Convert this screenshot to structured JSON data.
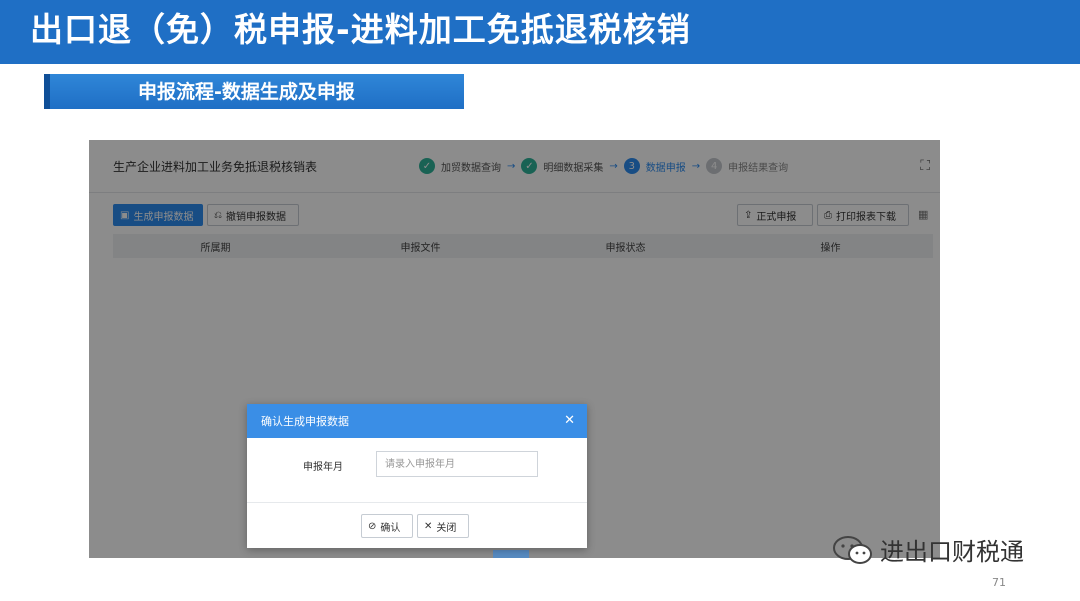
{
  "slide": {
    "title": "出口退（免）税申报-进料加工免抵退税核销",
    "subtitle": "申报流程-数据生成及申报",
    "page_number": "71",
    "watermark": "进出口财税通"
  },
  "app": {
    "title": "生产企业进料加工业务免抵退税核销表",
    "steps": [
      {
        "label": "加贸数据查询",
        "state": "done"
      },
      {
        "label": "明细数据采集",
        "state": "done"
      },
      {
        "label": "数据申报",
        "state": "active",
        "number": "3"
      },
      {
        "label": "申报结果查询",
        "state": "pending",
        "number": "4"
      }
    ],
    "toolbar": {
      "generate_label": "生成申报数据",
      "cancel_label": "撤销申报数据",
      "formal_label": "正式申报",
      "print_label": "打印报表下载"
    },
    "table": {
      "columns": [
        "所属期",
        "申报文件",
        "申报状态",
        "操作"
      ]
    }
  },
  "dialog": {
    "title": "确认生成申报数据",
    "month_label": "申报年月",
    "month_placeholder": "请录入申报年月",
    "confirm_label": "确认",
    "close_label": "关闭"
  },
  "colors": {
    "brand_blue": "#1f6fc5",
    "dialog_blue": "#3a8ee6",
    "step_done": "#2fb39a",
    "step_active": "#2d8cf0"
  }
}
